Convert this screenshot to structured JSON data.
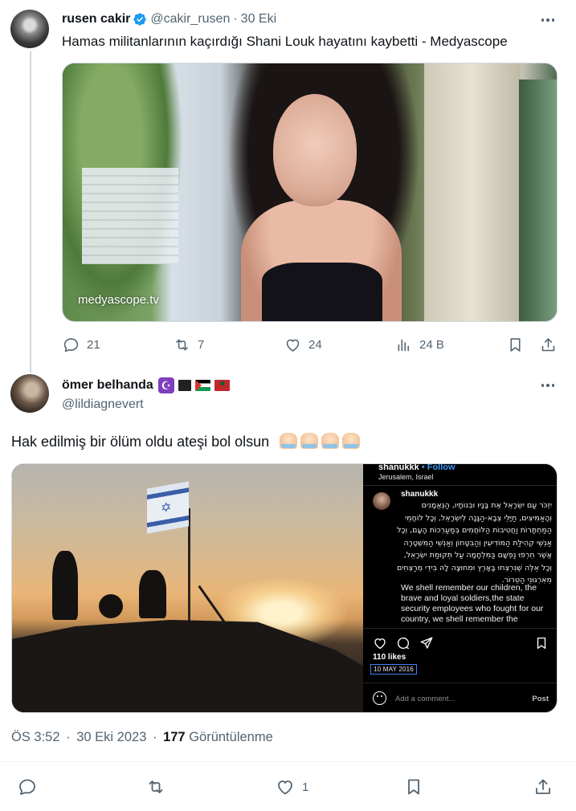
{
  "tweet1": {
    "author_name": "rusen cakir",
    "handle": "@cakir_rusen",
    "separator": "·",
    "date": "30 Eki",
    "text": "Hamas militanlarının kaçırdığı Shani Louk hayatını kaybetti - Medyascope",
    "media_caption": "medyascope.tv",
    "actions": {
      "replies": "21",
      "reposts": "7",
      "likes": "24",
      "views": "24 B"
    }
  },
  "tweet2": {
    "author_name": "ömer belhanda",
    "handle": "@lildiagnevert",
    "text": "Hak edilmiş bir ölüm oldu ateşi bol olsun",
    "post_image": {
      "ig_username": "shanukkk",
      "ig_follow": "• Follow",
      "ig_location": "Jerusalem, Israel",
      "ig_comment_user": "shanukkk",
      "ig_hebrew": "יִזְכֹּר עַם יִשְׂרָאֵל אֶת בָּנָיו וּבְנוֹתָיו, הַנֶּאֱמָנִים וְהָאַמִּיצִים, חַיָּלֵי צְבָא-הַגָּנָה לְיִשְׂרָאֵל, וְכָל לוֹחֲמֵי הַמַּחְתָּרוֹת וַחֲטִיבוֹת הַלּוֹחֲמִים בְּמַעַרְכוֹת הָעָם, וְכָל אַנְשֵׁי קְהִילַּת הַמּוֹדִיעִין וְהַבִּטָּחוֹן וְאַנְשֵׁי הַמִּשְׁטָרָה אֲשֶׁר חֵרְפוּ נַפְשָׁם בַּמִּלְחָמָה עַל תְּקוּמַת יִשְׂרָאֵל, וְכָל אֵלֶּה שֶׁנִּרְצְחוּ בָּאָרֶץ וּמִחוּצָה לָהּ בִּידֵי מְרַצְּחִים מֵאִרְגּוּנֵי הַטֵּרוֹר.",
      "ig_english": "We shell remember our children, the brave and loyal soldiers,the state security employees who fought for our country, we shell remember the",
      "ig_likes": "110 likes",
      "ig_date": "10 MAY 2016",
      "ig_comment_placeholder": "Add a comment...",
      "ig_post": "Post"
    },
    "meta": {
      "time": "ÖS 3:52",
      "separator": "·",
      "date": "30 Eki 2023",
      "views_count": "177",
      "views_label": "Görüntülenme"
    },
    "actions": {
      "likes": "1"
    }
  },
  "colors": {
    "text_primary": "#0f1419",
    "text_secondary": "#536471",
    "verified_blue": "#1d9bf0",
    "border": "#cfd9de"
  },
  "icons": [
    "more-icon",
    "verified-badge-icon",
    "reply-icon",
    "repost-icon",
    "like-icon",
    "views-icon",
    "bookmark-icon",
    "share-icon"
  ]
}
